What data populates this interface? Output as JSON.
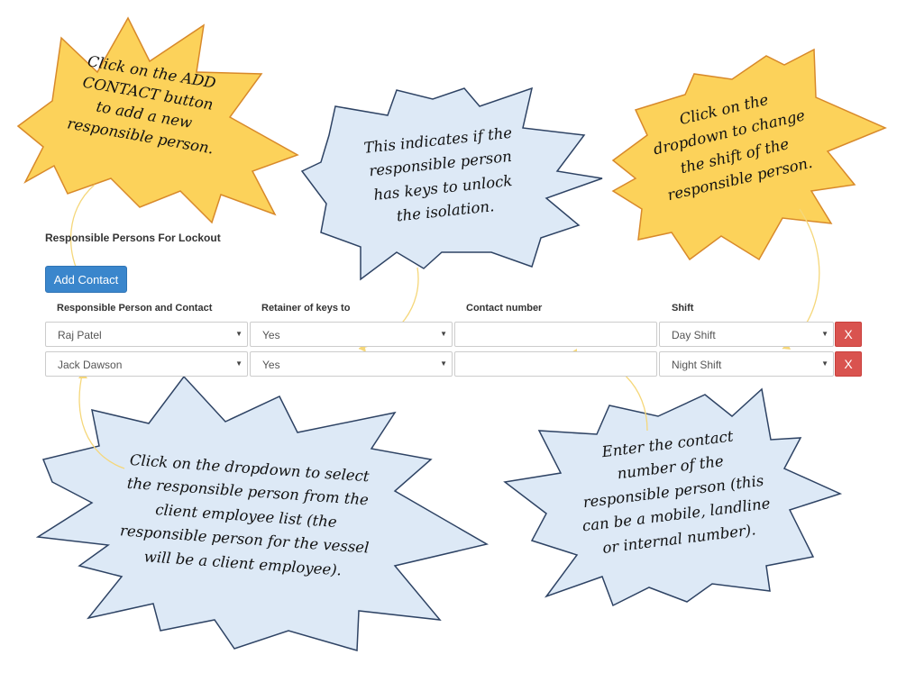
{
  "section_title": "Responsible Persons For Lockout",
  "add_button_label": "Add Contact",
  "columns": {
    "person": "Responsible Person and Contact",
    "keys": "Retainer of keys to",
    "contact": "Contact number",
    "shift": "Shift"
  },
  "rows": [
    {
      "person": "Raj Patel",
      "keys": "Yes",
      "contact": "",
      "shift": "Day Shift",
      "delete": "X"
    },
    {
      "person": "Jack Dawson",
      "keys": "Yes",
      "contact": "",
      "shift": "Night Shift",
      "delete": "X"
    }
  ],
  "callouts": {
    "add_contact": [
      "Click on the ADD",
      "CONTACT button",
      "to add a new",
      "responsible person."
    ],
    "keys": [
      "This indicates if the",
      "responsible person",
      "has keys to unlock",
      "the isolation."
    ],
    "shift": [
      "Click on the",
      "dropdown to change",
      "the shift of the",
      "responsible person."
    ],
    "person": [
      "Click on the dropdown to select",
      "the responsible person from the",
      "client employee list (the",
      "responsible person for the vessel",
      "will be a client employee)."
    ],
    "contact": [
      "Enter the contact",
      "number of the",
      "responsible person (this",
      "can be a mobile, landline",
      "or internal number)."
    ]
  },
  "colors": {
    "burst_yellow": "#fcd25a",
    "burst_yellow_border": "#d8892a",
    "burst_blue": "#dde9f6",
    "burst_blue_border": "#2e4364",
    "primary": "#3a86cc",
    "danger": "#d9534f",
    "arrow": "#f5d77a"
  }
}
